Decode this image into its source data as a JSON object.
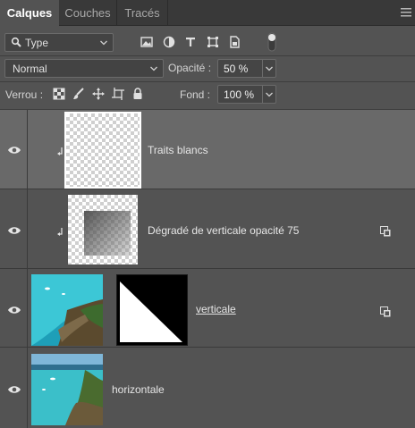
{
  "tabs": [
    {
      "label": "Calques",
      "active": true
    },
    {
      "label": "Couches",
      "active": false
    },
    {
      "label": "Tracés",
      "active": false
    }
  ],
  "panel_menu_icon": "hamburger-menu-icon",
  "filter": {
    "kind_label": "Type",
    "icons": [
      "image-filter-icon",
      "adjustment-filter-icon",
      "type-filter-icon",
      "shape-filter-icon",
      "smart-object-filter-icon"
    ]
  },
  "blend": {
    "mode": "Normal",
    "opacity_label": "Opacité :",
    "opacity_value": "50 %"
  },
  "lock": {
    "label": "Verrou :",
    "icons": [
      "lock-transparent-pixels-icon",
      "lock-image-pixels-icon",
      "lock-position-icon",
      "lock-artboard-icon",
      "lock-all-icon"
    ],
    "fill_label": "Fond :",
    "fill_value": "100 %"
  },
  "layers": [
    {
      "name": "Traits blancs",
      "visible": true,
      "selected": true,
      "clipped": true,
      "thumbnail": "transparent-checkerboard",
      "smart_object": false
    },
    {
      "name": "Dégradé de verticale opacité 75",
      "visible": true,
      "selected": false,
      "clipped": true,
      "thumbnail": "checkerboard-with-gray-gradient",
      "smart_object": true
    },
    {
      "name": "verticale",
      "visible": true,
      "selected": false,
      "clipped": false,
      "thumbnail": "coastal-aerial-photo",
      "mask": "black-white-diagonal-mask",
      "smart_object": true
    },
    {
      "name": "horizontale",
      "visible": true,
      "selected": false,
      "clipped": false,
      "thumbnail": "coastal-aerial-photo",
      "smart_object": false
    }
  ],
  "colors": {
    "panel_bg": "#535353",
    "selected_layer": "#696969",
    "tab_bar": "#393939"
  }
}
